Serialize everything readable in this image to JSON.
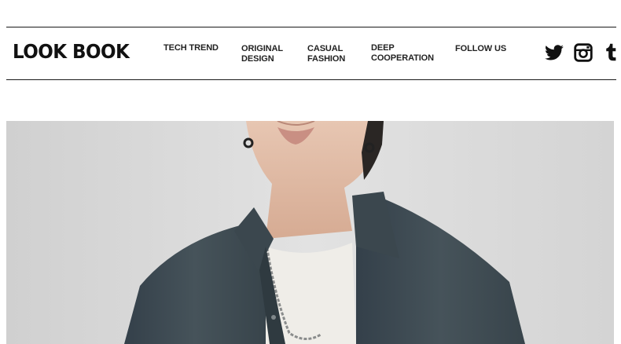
{
  "header": {
    "logo": "LOOK BOOK",
    "nav": [
      {
        "lines": [
          "TECH TREND"
        ]
      },
      {
        "lines": [
          "ORIGINAL",
          "DESIGN"
        ]
      },
      {
        "lines": [
          "CASUAL",
          "FASHION"
        ]
      },
      {
        "lines": [
          "DEEP",
          "COOPERATION"
        ]
      },
      {
        "lines": [
          "FOLLOW US"
        ]
      }
    ],
    "social_icons": [
      "twitter-icon",
      "instagram-icon",
      "tumblr-icon"
    ]
  },
  "colors": {
    "text": "#111111",
    "background": "#ffffff",
    "photo_background": "#dcdcdc",
    "shirt": "#3f4a4e"
  }
}
